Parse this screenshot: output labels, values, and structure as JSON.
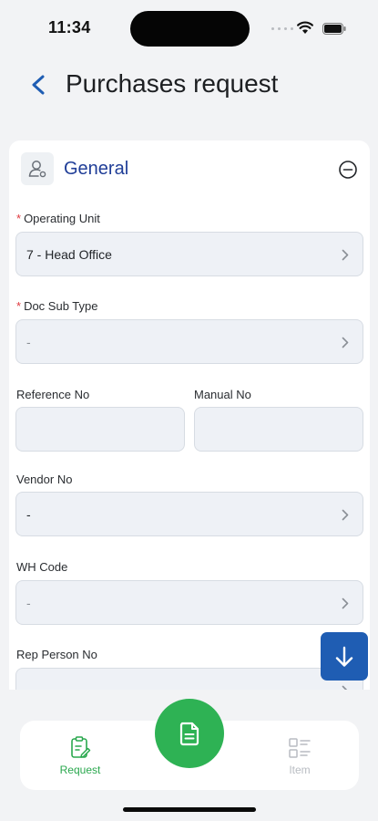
{
  "status_bar": {
    "time": "11:34"
  },
  "header": {
    "title": "Purchases request"
  },
  "section": {
    "title": "General"
  },
  "fields": {
    "operating_unit": {
      "label": "Operating Unit",
      "required": "*",
      "value": "7 - Head Office"
    },
    "doc_sub_type": {
      "label": "Doc Sub Type",
      "required": "*",
      "value": "-"
    },
    "reference_no": {
      "label": "Reference No",
      "value": ""
    },
    "manual_no": {
      "label": "Manual No",
      "value": ""
    },
    "vendor_no": {
      "label": "Vendor No",
      "value": "-"
    },
    "wh_code": {
      "label": "WH Code",
      "value": "-"
    },
    "rep_person_no": {
      "label": "Rep Person No",
      "value": ""
    }
  },
  "bottom_nav": {
    "request_label": "Request",
    "item_label": "Item"
  },
  "colors": {
    "accent_blue": "#1f3d97",
    "scroll_button": "#1f5db3",
    "active_green": "#2eb254",
    "required_red": "#e0393e"
  },
  "icons": [
    "back-chevron-icon",
    "user-settings-icon",
    "collapse-minus-icon",
    "chevron-right-icon",
    "arrow-down-icon",
    "clipboard-edit-icon",
    "document-icon",
    "list-icon"
  ]
}
